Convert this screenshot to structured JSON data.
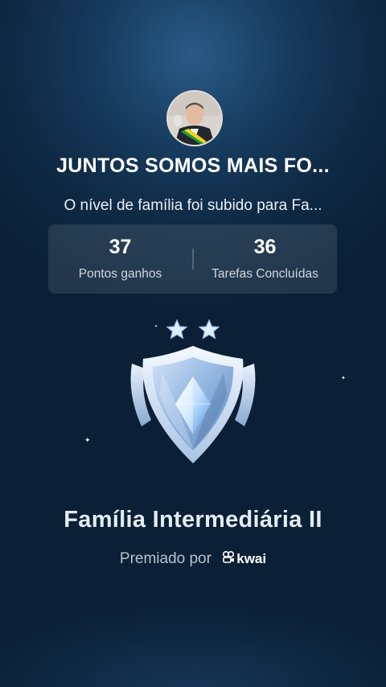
{
  "group": {
    "title": "JUNTOS SOMOS MAIS FO...",
    "level_message": "O nível de família foi subido para Fa..."
  },
  "stats": [
    {
      "value": "37",
      "label": "Pontos ganhos"
    },
    {
      "value": "36",
      "label": "Tarefas Concluídas"
    }
  ],
  "badge": {
    "stars": 2,
    "title": "Família Intermediária II"
  },
  "awarded": {
    "prefix": "Premiado por",
    "brand": "kwai"
  }
}
